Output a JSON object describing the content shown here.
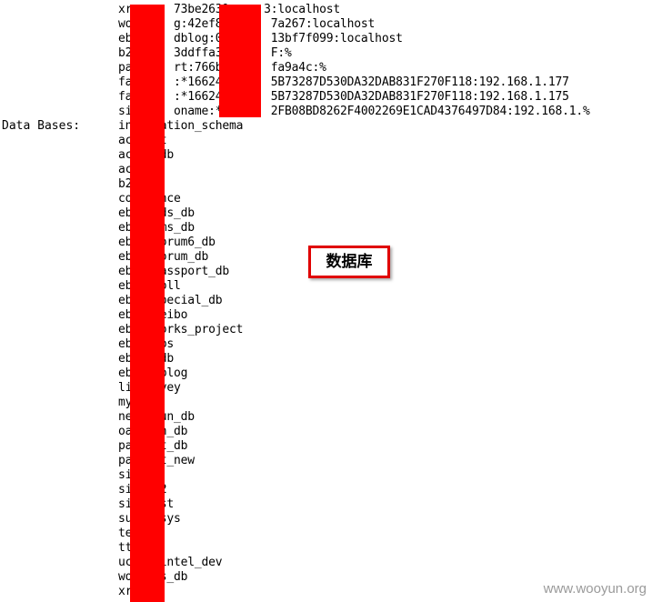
{
  "user_lines": [
    "xr      73be2631     3:localhost",
    "wo      g:42ef86      7a267:localhost",
    "eb      dblog:05      13bf7f099:localhost",
    "b2      3ddffa35      F:%",
    "pa      rt:766b4      fa9a4c:%",
    "fa      :*166247      5B73287D530DA32DAB831F270F118:192.168.1.177",
    "fa      :*166247      5B73287D530DA32DAB831F270F118:192.168.1.175",
    "si      oname:*7      2FB08BD8262F4002269E1CAD4376497D84:192.168.1.%"
  ],
  "databases_label": "Data Bases:",
  "databases": [
    "information_schema",
    "ac   ct",
    "ac   _db",
    "ac   2",
    "b2",
    "co   ence",
    "eb   ads_db",
    "eb   cms_db",
    "eb   forum6_db",
    "eb   forum_db",
    "eb   passport_db",
    "eb   poll",
    "eb   special_db",
    "eb   weibo",
    "eb   works_project",
    "eb   obs",
    "eb   _db",
    "eb   dblog",
    "li   rvey",
    "my",
    "ne   run_db",
    "oa   un_db",
    "pa   rt_db",
    "pa   rt_new",
    "si   o",
    "si   o2",
    "si   est",
    "su   _sys",
    "te",
    "tt",
    "uc   _intel_dev",
    "wo   gs_db",
    "xr"
  ],
  "annotation": "数据库",
  "watermark": "www.wooyun.org"
}
